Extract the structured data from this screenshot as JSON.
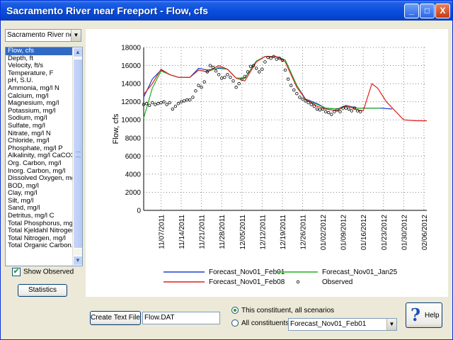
{
  "window": {
    "title": "Sacramento River near Freeport - Flow, cfs",
    "minimize_label": "_",
    "maximize_label": "□",
    "close_label": "X"
  },
  "location_select": {
    "value": "Sacramento River near"
  },
  "constituents": {
    "selected_index": 0,
    "items": [
      "Flow, cfs",
      "Depth, ft",
      "Velocity, ft/s",
      "Temperature, F",
      "pH, S.U.",
      "Ammonia, mg/l N",
      "Calcium, mg/l",
      "Magnesium, mg/l",
      "Potassium, mg/l",
      "Sodium, mg/l",
      "Sulfate, mg/l",
      "Nitrate, mg/l N",
      "Chloride, mg/l",
      "Phosphate, mg/l P",
      "Alkalinity, mg/l CaCO3",
      "Org. Carbon, mg/l",
      "Inorg. Carbon, mg/l",
      "Dissolved Oxygen, mg/l",
      "BOD, mg/l",
      "Clay, mg/l",
      "Silt, mg/l",
      "Sand, mg/l",
      "Detritus, mg/l C",
      "Total Phosphorus, mg/l",
      "Total Kjeldahl Nitrogen,",
      "Total Nitrogen, mg/l",
      "Total Organic Carbon, n"
    ]
  },
  "show_observed": {
    "label": "Show Observed",
    "checked": true
  },
  "statistics_button": "Statistics",
  "bottom": {
    "create_text_file_button": "Create Text File",
    "filename_value": "Flow.DAT",
    "radio_this": "This constituent, all scenarios",
    "radio_all": "All constituents,",
    "scenario_select": "Forecast_Nov01_Feb01",
    "help_button": "Help"
  },
  "chart_data": {
    "type": "line",
    "title": "",
    "xlabel": "",
    "ylabel": "Flow, cfs",
    "ylim": [
      0,
      18000
    ],
    "yticks": [
      0,
      2000,
      4000,
      6000,
      8000,
      10000,
      12000,
      14000,
      16000,
      18000
    ],
    "x_tick_labels": [
      "11/07/2011",
      "11/14/2011",
      "11/21/2011",
      "11/28/2011",
      "12/05/2011",
      "12/12/2011",
      "12/19/2011",
      "12/26/2011",
      "01/02/2012",
      "01/09/2012",
      "01/16/2012",
      "01/23/2012",
      "01/30/2012",
      "02/06/2012"
    ],
    "x_start": "2011-11-01",
    "xlim": [
      0,
      98
    ],
    "grid": true,
    "legend_placement": "bottom",
    "series": [
      {
        "name": "Forecast_Nov01_Feb01",
        "color": "#2040d0",
        "points": [
          [
            0,
            12500
          ],
          [
            3,
            14500
          ],
          [
            6,
            15500
          ],
          [
            9,
            15000
          ],
          [
            12,
            14700
          ],
          [
            16,
            14700
          ],
          [
            19,
            15700
          ],
          [
            22,
            15500
          ],
          [
            26,
            15700
          ],
          [
            29,
            15600
          ],
          [
            32,
            14600
          ],
          [
            35,
            14600
          ],
          [
            39,
            16500
          ],
          [
            42,
            17000
          ],
          [
            46,
            17000
          ],
          [
            49,
            16600
          ],
          [
            53,
            13800
          ],
          [
            56,
            12300
          ],
          [
            60,
            11800
          ],
          [
            63,
            11300
          ],
          [
            67,
            11200
          ],
          [
            70,
            11600
          ],
          [
            74,
            11300
          ],
          [
            78,
            11300
          ],
          [
            82,
            11300
          ],
          [
            86,
            11200
          ]
        ]
      },
      {
        "name": "Forecast_Nov01_Jan25",
        "color": "#20b020",
        "points": [
          [
            0,
            10200
          ],
          [
            3,
            13500
          ],
          [
            6,
            15400
          ],
          [
            9,
            15000
          ],
          [
            12,
            14700
          ],
          [
            16,
            14700
          ],
          [
            19,
            15500
          ],
          [
            22,
            15300
          ],
          [
            26,
            15800
          ],
          [
            29,
            15600
          ],
          [
            32,
            14600
          ],
          [
            35,
            14600
          ],
          [
            39,
            16500
          ],
          [
            42,
            17000
          ],
          [
            46,
            17000
          ],
          [
            49,
            16600
          ],
          [
            53,
            13800
          ],
          [
            56,
            12200
          ],
          [
            60,
            11700
          ],
          [
            63,
            11300
          ],
          [
            67,
            11200
          ],
          [
            70,
            11500
          ],
          [
            74,
            11300
          ],
          [
            78,
            11300
          ],
          [
            82,
            11300
          ]
        ]
      },
      {
        "name": "Forecast_Nov01_Feb08",
        "color": "#e02020",
        "points": [
          [
            0,
            12800
          ],
          [
            3,
            14000
          ],
          [
            6,
            15600
          ],
          [
            9,
            15000
          ],
          [
            12,
            14700
          ],
          [
            16,
            14700
          ],
          [
            19,
            15500
          ],
          [
            22,
            15300
          ],
          [
            26,
            16000
          ],
          [
            29,
            15600
          ],
          [
            32,
            14600
          ],
          [
            35,
            14300
          ],
          [
            39,
            16400
          ],
          [
            42,
            17000
          ],
          [
            46,
            17000
          ],
          [
            49,
            16400
          ],
          [
            53,
            13600
          ],
          [
            56,
            12300
          ],
          [
            60,
            11500
          ],
          [
            63,
            11200
          ],
          [
            67,
            11000
          ],
          [
            70,
            11600
          ],
          [
            74,
            11100
          ],
          [
            76,
            11000
          ],
          [
            79,
            14000
          ],
          [
            81,
            13500
          ],
          [
            84,
            12000
          ],
          [
            87,
            11000
          ],
          [
            90,
            10000
          ],
          [
            94,
            9900
          ],
          [
            98,
            9900
          ]
        ]
      },
      {
        "name": "Observed",
        "color": "#000000",
        "marker": "circle",
        "points": [
          [
            0,
            11700
          ],
          [
            1,
            11800
          ],
          [
            2,
            11600
          ],
          [
            3,
            11900
          ],
          [
            4,
            11700
          ],
          [
            5,
            11800
          ],
          [
            6,
            11900
          ],
          [
            7,
            12000
          ],
          [
            8,
            11700
          ],
          [
            9,
            11900
          ],
          [
            10,
            11200
          ],
          [
            11,
            11500
          ],
          [
            12,
            11800
          ],
          [
            13,
            12000
          ],
          [
            14,
            12100
          ],
          [
            15,
            12200
          ],
          [
            16,
            12200
          ],
          [
            17,
            12500
          ],
          [
            18,
            13200
          ],
          [
            19,
            13800
          ],
          [
            20,
            13600
          ],
          [
            21,
            14200
          ],
          [
            22,
            15300
          ],
          [
            23,
            16000
          ],
          [
            24,
            15800
          ],
          [
            25,
            15400
          ],
          [
            26,
            15000
          ],
          [
            27,
            14600
          ],
          [
            28,
            14700
          ],
          [
            29,
            15000
          ],
          [
            30,
            14700
          ],
          [
            31,
            14300
          ],
          [
            32,
            13600
          ],
          [
            33,
            14000
          ],
          [
            34,
            14500
          ],
          [
            35,
            14800
          ],
          [
            36,
            15300
          ],
          [
            37,
            15900
          ],
          [
            38,
            16000
          ],
          [
            39,
            15700
          ],
          [
            40,
            15300
          ],
          [
            41,
            15600
          ],
          [
            42,
            16400
          ],
          [
            43,
            16900
          ],
          [
            44,
            16800
          ],
          [
            45,
            17000
          ],
          [
            46,
            16700
          ],
          [
            47,
            16800
          ],
          [
            48,
            16600
          ],
          [
            49,
            15500
          ],
          [
            50,
            14500
          ],
          [
            51,
            13800
          ],
          [
            52,
            13300
          ],
          [
            53,
            12900
          ],
          [
            54,
            12500
          ],
          [
            55,
            12300
          ],
          [
            56,
            12100
          ],
          [
            57,
            11900
          ],
          [
            58,
            11700
          ],
          [
            59,
            11500
          ],
          [
            60,
            11200
          ],
          [
            61,
            11100
          ],
          [
            62,
            11200
          ],
          [
            63,
            10900
          ],
          [
            64,
            10800
          ],
          [
            65,
            10600
          ],
          [
            66,
            10900
          ],
          [
            67,
            11100
          ],
          [
            68,
            10900
          ],
          [
            69,
            11300
          ],
          [
            70,
            11300
          ],
          [
            71,
            11200
          ],
          [
            72,
            11000
          ],
          [
            73,
            11300
          ],
          [
            74,
            11000
          ],
          [
            75,
            10900
          ]
        ]
      }
    ]
  }
}
